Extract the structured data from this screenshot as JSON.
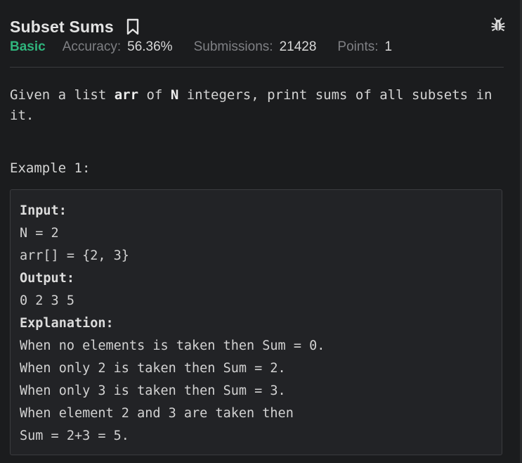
{
  "problem": {
    "title": "Subset Sums",
    "difficulty": "Basic",
    "accuracy_label": "Accuracy:",
    "accuracy_value": "56.36%",
    "submissions_label": "Submissions:",
    "submissions_value": "21428",
    "points_label": "Points:",
    "points_value": "1",
    "icons": {
      "bookmark": "bookmark-icon",
      "report": "bug-icon"
    },
    "colors": {
      "difficulty": "#2fb47c",
      "background": "#1b1c1e"
    }
  },
  "statement": {
    "p1": "Given a list ",
    "arr": "arr",
    "p2": " of ",
    "n": "N",
    "p3": " integers, print sums of all subsets in it."
  },
  "example": {
    "title": "Example 1:",
    "input_label": "Input:",
    "input_lines": [
      "N = 2",
      "arr[] = {2, 3}"
    ],
    "output_label": "Output:",
    "output_lines": [
      "0 2 3 5"
    ],
    "explanation_label": "Explanation:",
    "explanation_lines": [
      "When no elements is taken then Sum = 0.",
      "When only 2 is taken then Sum = 2.",
      "When only 3 is taken then Sum = 3.",
      "When element 2 and 3 are taken then",
      "Sum = 2+3 = 5."
    ]
  }
}
